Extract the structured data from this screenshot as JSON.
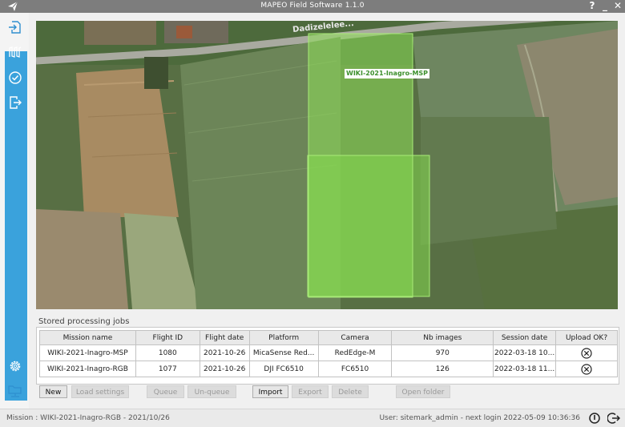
{
  "window": {
    "title": "MAPEO Field Software 1.1.0",
    "help_glyph": "?",
    "minimize_glyph": "_",
    "close_glyph": "✕"
  },
  "sidebar": {
    "items": [
      {
        "icon": "import-icon"
      },
      {
        "icon": "flight-lines-icon"
      },
      {
        "icon": "check-circle-icon"
      },
      {
        "icon": "export-icon"
      },
      {
        "icon": "settings-icon"
      },
      {
        "icon": "folder-network-icon"
      }
    ]
  },
  "map": {
    "road_label": "Dadizelelee...",
    "mission_label": "WIKI-2021-Inagro-MSP"
  },
  "jobs": {
    "section_title": "Stored processing jobs",
    "columns": [
      "Mission name",
      "Flight ID",
      "Flight date",
      "Platform",
      "Camera",
      "Nb images",
      "Session date",
      "Upload OK?"
    ],
    "rows": [
      [
        "WIKI-2021-Inagro-MSP",
        "1080",
        "2021-10-26",
        "MicaSense Red...",
        "RedEdge-M",
        "970",
        "2022-03-18 10...",
        "x-circle-icon"
      ],
      [
        "WIKI-2021-Inagro-RGB",
        "1077",
        "2021-10-26",
        "DJI FC6510",
        "FC6510",
        "126",
        "2022-03-18 11...",
        "x-circle-icon"
      ]
    ]
  },
  "buttons": {
    "new": "New",
    "load_settings": "Load settings",
    "queue": "Queue",
    "unqueue": "Un-queue",
    "import": "Import",
    "export": "Export",
    "delete": "Delete",
    "open_folder": "Open folder"
  },
  "status": {
    "mission": "Mission : WIKI-2021-Inagro-RGB - 2021/10/26",
    "user": "User: sitemark_admin - next login 2022-05-09 10:36:36"
  },
  "colors": {
    "accent": "#3aa2dc",
    "overlay_green": "#7ed348",
    "titlebar": "#7d7d7d"
  }
}
